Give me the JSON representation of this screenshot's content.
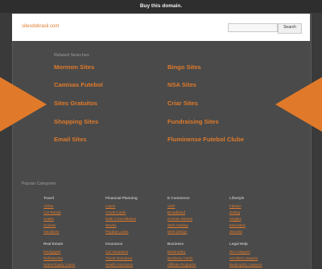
{
  "topbar": {
    "text": "Buy this domain."
  },
  "header": {
    "domain": "sitesdobrasil.com",
    "search_placeholder": "",
    "search_button": "Search"
  },
  "related": {
    "title": "Related Searches",
    "left": [
      "Mormon Sites",
      "Camisas Futebol",
      "Sites Gratuitos",
      "Shopping Sites",
      "Email Sites"
    ],
    "right": [
      "Bingo Sites",
      "NSA Sites",
      "Criar Sites",
      "Fundraising Sites",
      "Fluminense Futebol Clube"
    ]
  },
  "categories": {
    "title": "Popular Categories",
    "row1": [
      {
        "head": "Travel",
        "items": [
          "Airline",
          "Car Rental",
          "Hotels",
          "Cruises",
          "Vacations"
        ]
      },
      {
        "head": "Financial Planning",
        "items": [
          "Loans",
          "Credit Cards",
          "Debt Consolidation",
          "Stocks",
          "Payday Loans"
        ]
      },
      {
        "head": "E Commerce",
        "items": [
          "VoIP",
          "Broadband",
          "Domain Names",
          "Web Hosting",
          "Web Design"
        ]
      },
      {
        "head": "Lifestyle",
        "items": [
          "Fitness",
          "Dating",
          "Singles",
          "Education",
          "Diworks"
        ]
      }
    ],
    "row2": [
      {
        "head": "Real Estate",
        "items": [
          "Mortgages",
          "Refinancing",
          "Home Equity Loans"
        ]
      },
      {
        "head": "Insurance",
        "items": [
          "Car Insurance",
          "Travel Insurance",
          "Health Insurance"
        ]
      },
      {
        "head": "Business",
        "items": [
          "Bankruptcy",
          "Business Cards",
          "Affiliate Programs"
        ]
      },
      {
        "head": "Legal Help",
        "items": [
          "DUI Lawyers",
          "Accident Lawyers",
          "Bankruptcy Lawyers"
        ]
      }
    ]
  },
  "colors": {
    "accent": "#e07a2a",
    "background": "#3a3a3a",
    "panel": "#4a4a4a"
  }
}
